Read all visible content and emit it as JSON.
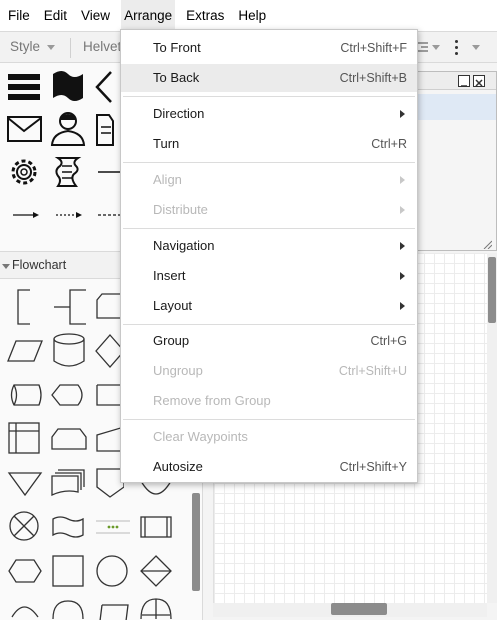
{
  "menubar": {
    "items": [
      {
        "label": "File"
      },
      {
        "label": "Edit"
      },
      {
        "label": "View"
      },
      {
        "label": "Arrange"
      },
      {
        "label": "Extras"
      },
      {
        "label": "Help"
      }
    ]
  },
  "toolbar": {
    "style_label": "Style",
    "font_label": "Helvet"
  },
  "sidebar": {
    "section_label": "Flowchart"
  },
  "arrange_menu": {
    "items": [
      {
        "label": "To Front",
        "shortcut": "Ctrl+Shift+F"
      },
      {
        "label": "To Back",
        "shortcut": "Ctrl+Shift+B"
      },
      {
        "label": "Direction"
      },
      {
        "label": "Turn",
        "shortcut": "Ctrl+R"
      },
      {
        "label": "Align"
      },
      {
        "label": "Distribute"
      },
      {
        "label": "Navigation"
      },
      {
        "label": "Insert"
      },
      {
        "label": "Layout"
      },
      {
        "label": "Group",
        "shortcut": "Ctrl+G"
      },
      {
        "label": "Ungroup",
        "shortcut": "Ctrl+Shift+U"
      },
      {
        "label": "Remove from Group"
      },
      {
        "label": "Clear Waypoints"
      },
      {
        "label": "Autosize",
        "shortcut": "Ctrl+Shift+Y"
      }
    ]
  }
}
